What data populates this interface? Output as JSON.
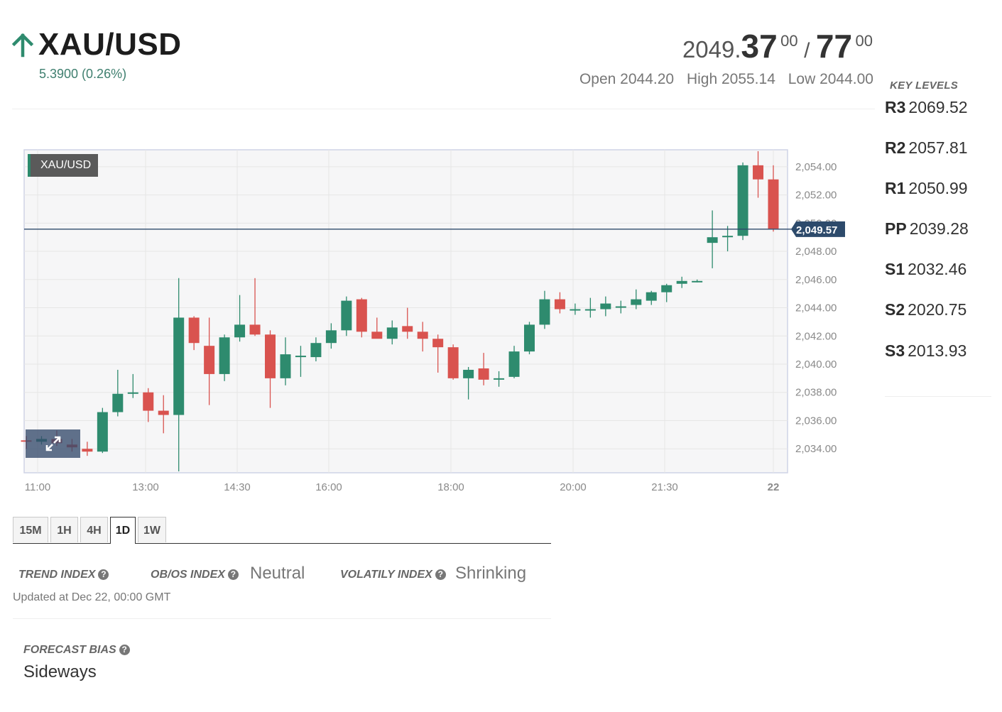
{
  "header": {
    "symbol": "XAU/USD",
    "direction_icon": "arrow-up-icon",
    "change": "5.3900 (0.26%)",
    "price": {
      "bid_int": "2049.",
      "bid_big": "37",
      "bid_sup": "00",
      "slash": "/",
      "ask_big": "77",
      "ask_sup": "00"
    },
    "open": "Open 2044.20",
    "high": "High 2055.14",
    "low": "Low 2044.00"
  },
  "key_levels": {
    "title": "KEY LEVELS",
    "items": [
      {
        "label": "R3",
        "value": "2069.52"
      },
      {
        "label": "R2",
        "value": "2057.81"
      },
      {
        "label": "R1",
        "value": "2050.99"
      },
      {
        "label": "PP",
        "value": "2039.28"
      },
      {
        "label": "S1",
        "value": "2032.46"
      },
      {
        "label": "S2",
        "value": "2020.75"
      },
      {
        "label": "S3",
        "value": "2013.93"
      }
    ]
  },
  "chart_data": {
    "type": "candlestick",
    "legend": "XAU/USD",
    "current_price_label": "2,049.57",
    "current_price": 2049.57,
    "ylim": [
      2032.3,
      2055.2
    ],
    "y_ticks": [
      2034,
      2036,
      2038,
      2040,
      2042,
      2044,
      2046,
      2048,
      2050,
      2052,
      2054
    ],
    "y_tick_labels": [
      "2,034.00",
      "2,036.00",
      "2,038.00",
      "2,040.00",
      "2,042.00",
      "2,044.00",
      "2,046.00",
      "2,048.00",
      "2,050.00",
      "2,052.00",
      "2,054.00"
    ],
    "x_tick_labels": [
      "11:00",
      "13:00",
      "14:30",
      "16:00",
      "18:00",
      "20:00",
      "21:30",
      "22"
    ],
    "grid": true,
    "colors": {
      "up": "#2e8b6e",
      "down": "#d9534f",
      "price_line": "#2d4a6b"
    },
    "candles": [
      [
        2034.6,
        2034.9,
        2034.0,
        2034.5
      ],
      [
        2034.5,
        2034.9,
        2034.3,
        2034.7
      ],
      [
        2034.7,
        2035.3,
        2034.2,
        2034.4
      ],
      [
        2034.3,
        2034.7,
        2033.8,
        2034.1
      ],
      [
        2034.0,
        2034.5,
        2033.5,
        2033.8
      ],
      [
        2033.8,
        2036.9,
        2033.7,
        2036.6
      ],
      [
        2036.6,
        2039.6,
        2036.3,
        2037.9
      ],
      [
        2037.9,
        2039.3,
        2037.6,
        2038.0
      ],
      [
        2038.0,
        2038.3,
        2035.9,
        2036.7
      ],
      [
        2036.7,
        2037.8,
        2035.1,
        2036.4
      ],
      [
        2036.4,
        2046.1,
        2032.4,
        2043.3
      ],
      [
        2043.3,
        2043.4,
        2041.0,
        2041.5
      ],
      [
        2041.3,
        2043.3,
        2037.1,
        2039.3
      ],
      [
        2039.3,
        2042.1,
        2038.8,
        2041.9
      ],
      [
        2041.9,
        2044.9,
        2041.6,
        2042.8
      ],
      [
        2042.8,
        2046.1,
        2042.0,
        2042.1
      ],
      [
        2042.1,
        2042.4,
        2036.9,
        2039.0
      ],
      [
        2039.0,
        2041.9,
        2038.5,
        2040.7
      ],
      [
        2040.6,
        2041.3,
        2039.1,
        2040.6
      ],
      [
        2040.5,
        2041.9,
        2040.2,
        2041.5
      ],
      [
        2041.5,
        2042.9,
        2041.1,
        2042.4
      ],
      [
        2042.4,
        2044.8,
        2042.0,
        2044.5
      ],
      [
        2044.6,
        2044.7,
        2041.9,
        2042.3
      ],
      [
        2042.3,
        2043.3,
        2041.9,
        2041.8
      ],
      [
        2041.8,
        2043.1,
        2041.4,
        2042.6
      ],
      [
        2042.7,
        2044.0,
        2041.8,
        2042.3
      ],
      [
        2042.3,
        2043.0,
        2040.9,
        2041.8
      ],
      [
        2041.8,
        2042.1,
        2039.4,
        2041.2
      ],
      [
        2041.2,
        2041.4,
        2038.9,
        2039.0
      ],
      [
        2039.0,
        2039.8,
        2037.5,
        2039.6
      ],
      [
        2039.7,
        2040.8,
        2038.5,
        2038.9
      ],
      [
        2038.9,
        2039.5,
        2038.4,
        2039.0
      ],
      [
        2039.1,
        2041.3,
        2039.0,
        2040.9
      ],
      [
        2040.9,
        2043.0,
        2040.7,
        2042.8
      ],
      [
        2042.8,
        2045.2,
        2042.5,
        2044.6
      ],
      [
        2044.6,
        2045.1,
        2043.6,
        2043.9
      ],
      [
        2043.9,
        2044.3,
        2043.5,
        2043.9
      ],
      [
        2043.8,
        2044.7,
        2043.3,
        2043.9
      ],
      [
        2043.9,
        2044.8,
        2043.4,
        2044.3
      ],
      [
        2044.1,
        2044.5,
        2043.6,
        2044.1
      ],
      [
        2044.2,
        2045.3,
        2043.9,
        2044.6
      ],
      [
        2044.5,
        2045.2,
        2044.2,
        2045.1
      ],
      [
        2045.1,
        2045.7,
        2044.4,
        2045.6
      ],
      [
        2045.7,
        2046.2,
        2045.4,
        2045.9
      ],
      [
        2045.9,
        2046.0,
        2045.8,
        2045.9
      ],
      [
        2048.6,
        2050.9,
        2046.8,
        2049.0
      ],
      [
        2049.0,
        2049.8,
        2048.0,
        2049.1
      ],
      [
        2049.1,
        2054.3,
        2048.8,
        2054.1
      ],
      [
        2054.1,
        2055.1,
        2051.8,
        2053.1
      ],
      [
        2053.1,
        2054.1,
        2049.4,
        2049.6
      ]
    ]
  },
  "timeframes": {
    "tabs": [
      "15M",
      "1H",
      "4H",
      "1D",
      "1W"
    ],
    "active": "1D"
  },
  "indices": {
    "trend_label": "TREND INDEX",
    "obos_label": "OB/OS INDEX",
    "obos_value": "Neutral",
    "volatility_label": "VOLATILY INDEX",
    "volatility_value": "Shrinking",
    "help_icon": "question-circle-icon",
    "updated": "Updated at Dec 22, 00:00 GMT"
  },
  "forecast": {
    "label": "FORECAST BIAS",
    "value": "Sideways"
  }
}
